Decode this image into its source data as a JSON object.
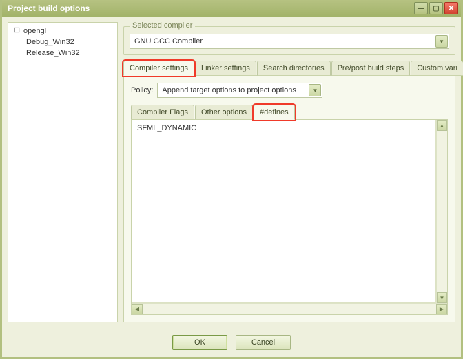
{
  "window": {
    "title": "Project build options"
  },
  "sidebar": {
    "root": "opengl",
    "items": [
      "Debug_Win32",
      "Release_Win32"
    ]
  },
  "compiler_group": {
    "legend": "Selected compiler",
    "value": "GNU GCC Compiler"
  },
  "tabs": {
    "items": [
      {
        "label": "Compiler settings",
        "active": true,
        "highlight": true
      },
      {
        "label": "Linker settings"
      },
      {
        "label": "Search directories"
      },
      {
        "label": "Pre/post build steps"
      },
      {
        "label": "Custom vari"
      }
    ]
  },
  "policy": {
    "label": "Policy:",
    "value": "Append target options to project options"
  },
  "subtabs": {
    "items": [
      {
        "label": "Compiler Flags"
      },
      {
        "label": "Other options"
      },
      {
        "label": "#defines",
        "active": true,
        "highlight": true
      }
    ]
  },
  "defines": {
    "text": "SFML_DYNAMIC"
  },
  "buttons": {
    "ok": "OK",
    "cancel": "Cancel"
  }
}
